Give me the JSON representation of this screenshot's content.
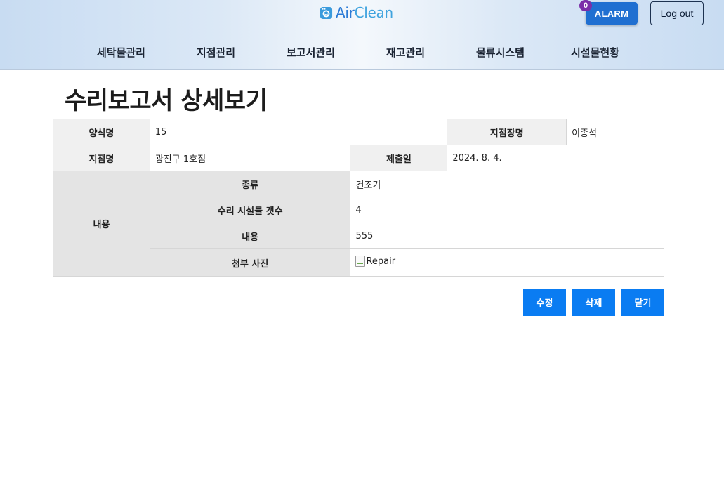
{
  "header": {
    "logo": {
      "air": "Air",
      "clean": "Clean"
    },
    "alarm_label": "ALARM",
    "alarm_count": "0",
    "logout_label": "Log out"
  },
  "nav": {
    "items": [
      {
        "label": "세탁물관리"
      },
      {
        "label": "지점관리"
      },
      {
        "label": "보고서관리"
      },
      {
        "label": "재고관리"
      },
      {
        "label": "물류시스템"
      },
      {
        "label": "시설물현황"
      }
    ]
  },
  "page": {
    "title": "수리보고서 상세보기"
  },
  "report": {
    "form_name_label": "양식명",
    "form_name_value": "15",
    "manager_label": "지점장명",
    "manager_value": "이종석",
    "branch_label": "지점명",
    "branch_value": "광진구 1호점",
    "submit_date_label": "제출일",
    "submit_date_value": "2024. 8. 4.",
    "content_label": "내용",
    "type_label": "종류",
    "type_value": "건조기",
    "repair_count_label": "수리 시설물 갯수",
    "repair_count_value": "4",
    "detail_label": "내용",
    "detail_value": "555",
    "photo_label": "첨부 사진",
    "photo_alt": "Repair"
  },
  "actions": {
    "edit_label": "수정",
    "delete_label": "삭제",
    "close_label": "닫기"
  },
  "colors": {
    "primary_button": "#0a7cf2",
    "alarm_button": "#1f6fd1",
    "alarm_badge": "#7b2fa8"
  }
}
